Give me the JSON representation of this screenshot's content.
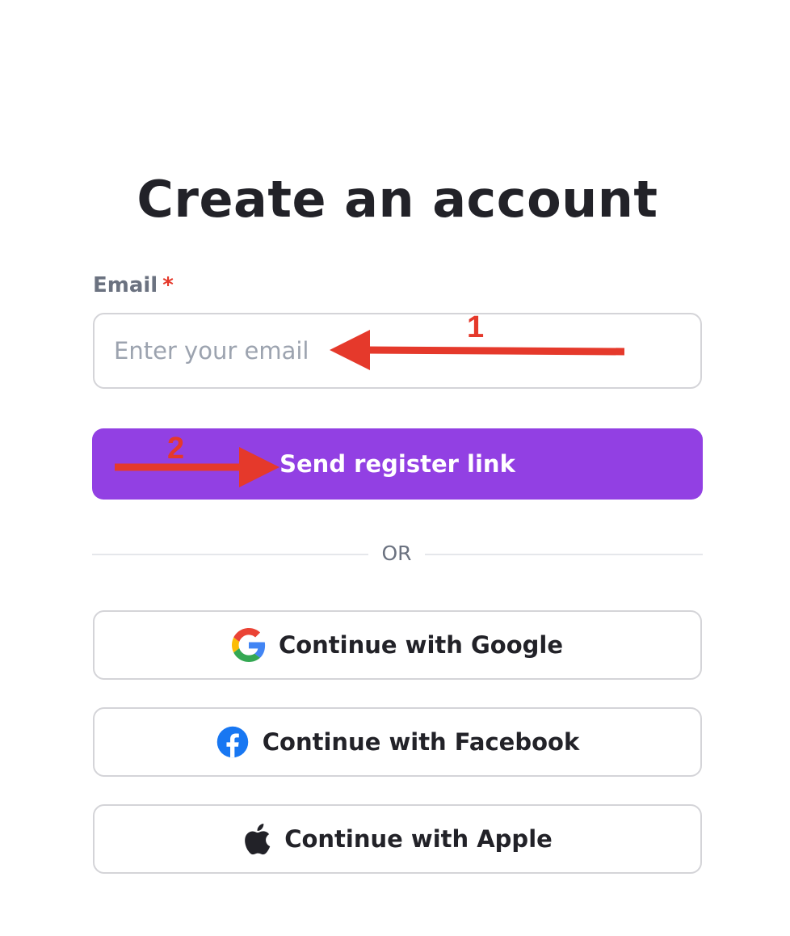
{
  "title": "Create an account",
  "email": {
    "label": "Email",
    "required_marker": "*",
    "placeholder": "Enter your email",
    "value": ""
  },
  "send_button": {
    "label": "Send register link",
    "color": "#9240e3"
  },
  "divider": {
    "label": "OR"
  },
  "social": [
    {
      "label": "Continue with Google",
      "icon": "google-icon"
    },
    {
      "label": "Continue with Facebook",
      "icon": "facebook-icon"
    },
    {
      "label": "Continue with Apple",
      "icon": "apple-icon"
    }
  ],
  "annotations": [
    {
      "number": "1",
      "color": "#e5392b"
    },
    {
      "number": "2",
      "color": "#e5392b"
    }
  ]
}
